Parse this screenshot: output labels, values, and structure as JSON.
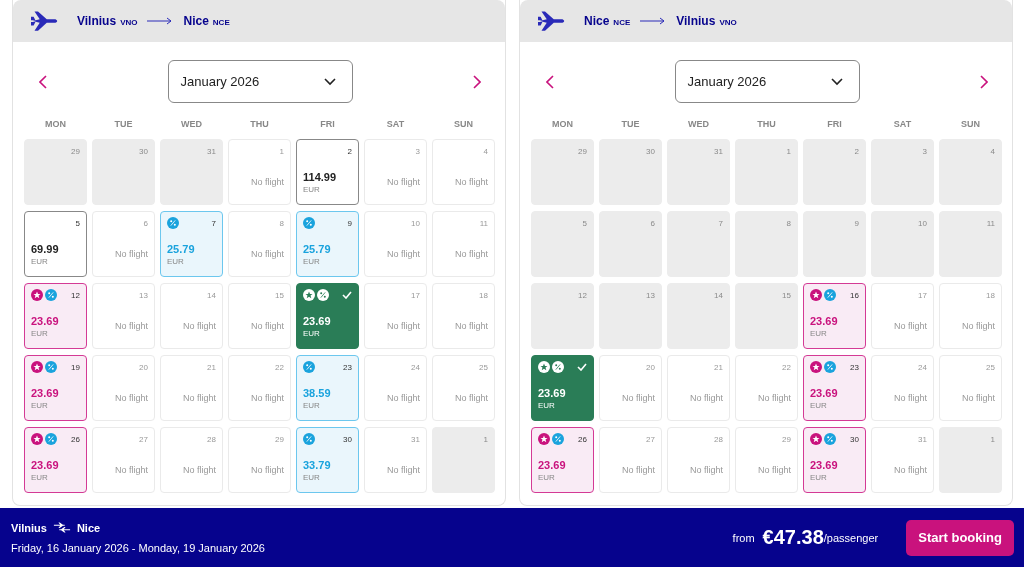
{
  "calendars": [
    {
      "origin": {
        "city": "Vilnius",
        "code": "VNO"
      },
      "destination": {
        "city": "Nice",
        "code": "NCE"
      },
      "month": "January 2026",
      "weekdays": [
        "MON",
        "TUE",
        "WED",
        "THU",
        "FRI",
        "SAT",
        "SUN"
      ],
      "days": [
        {
          "day": "29",
          "kind": "past",
          "selected": false
        },
        {
          "day": "30",
          "kind": "past",
          "selected": false
        },
        {
          "day": "31",
          "kind": "past",
          "selected": false
        },
        {
          "day": "1",
          "kind": "no_flight",
          "note": "No flight",
          "selected": false
        },
        {
          "day": "2",
          "kind": "regular_fare",
          "price": "114.99",
          "currency": "EUR",
          "selected": false
        },
        {
          "day": "3",
          "kind": "no_flight",
          "note": "No flight",
          "selected": false
        },
        {
          "day": "4",
          "kind": "no_flight",
          "note": "No flight",
          "selected": false
        },
        {
          "day": "5",
          "kind": "regular_fare",
          "price": "69.99",
          "currency": "EUR",
          "selected": false
        },
        {
          "day": "6",
          "kind": "no_flight",
          "note": "No flight",
          "selected": false
        },
        {
          "day": "7",
          "kind": "discount_fare",
          "price": "25.79",
          "currency": "EUR",
          "selected": false
        },
        {
          "day": "8",
          "kind": "no_flight",
          "note": "No flight",
          "selected": false
        },
        {
          "day": "9",
          "kind": "discount_fare",
          "price": "25.79",
          "currency": "EUR",
          "selected": false
        },
        {
          "day": "10",
          "kind": "no_flight",
          "note": "No flight",
          "selected": false
        },
        {
          "day": "11",
          "kind": "no_flight",
          "note": "No flight",
          "selected": false
        },
        {
          "day": "12",
          "kind": "club_fare",
          "price": "23.69",
          "currency": "EUR",
          "selected": false
        },
        {
          "day": "13",
          "kind": "no_flight",
          "note": "No flight",
          "selected": false
        },
        {
          "day": "14",
          "kind": "no_flight",
          "note": "No flight",
          "selected": false
        },
        {
          "day": "15",
          "kind": "no_flight",
          "note": "No flight",
          "selected": false
        },
        {
          "kind": "club_fare",
          "price": "23.69",
          "currency": "EUR",
          "selected": true
        },
        {
          "day": "17",
          "kind": "no_flight",
          "note": "No flight",
          "selected": false
        },
        {
          "day": "18",
          "kind": "no_flight",
          "note": "No flight",
          "selected": false
        },
        {
          "day": "19",
          "kind": "club_fare",
          "price": "23.69",
          "currency": "EUR",
          "selected": false
        },
        {
          "day": "20",
          "kind": "no_flight",
          "note": "No flight",
          "selected": false
        },
        {
          "day": "21",
          "kind": "no_flight",
          "note": "No flight",
          "selected": false
        },
        {
          "day": "22",
          "kind": "no_flight",
          "note": "No flight",
          "selected": false
        },
        {
          "day": "23",
          "kind": "discount_fare",
          "price": "38.59",
          "currency": "EUR",
          "selected": false
        },
        {
          "day": "24",
          "kind": "no_flight",
          "note": "No flight",
          "selected": false
        },
        {
          "day": "25",
          "kind": "no_flight",
          "note": "No flight",
          "selected": false
        },
        {
          "day": "26",
          "kind": "club_fare",
          "price": "23.69",
          "currency": "EUR",
          "selected": false
        },
        {
          "day": "27",
          "kind": "no_flight",
          "note": "No flight",
          "selected": false
        },
        {
          "day": "28",
          "kind": "no_flight",
          "note": "No flight",
          "selected": false
        },
        {
          "day": "29",
          "kind": "no_flight",
          "note": "No flight",
          "selected": false
        },
        {
          "day": "30",
          "kind": "discount_fare",
          "price": "33.79",
          "currency": "EUR",
          "selected": false
        },
        {
          "day": "31",
          "kind": "no_flight",
          "note": "No flight",
          "selected": false
        },
        {
          "day": "1",
          "kind": "past",
          "selected": false
        }
      ]
    },
    {
      "origin": {
        "city": "Nice",
        "code": "NCE"
      },
      "destination": {
        "city": "Vilnius",
        "code": "VNO"
      },
      "month": "January 2026",
      "weekdays": [
        "MON",
        "TUE",
        "WED",
        "THU",
        "FRI",
        "SAT",
        "SUN"
      ],
      "days": [
        {
          "day": "29",
          "kind": "past",
          "selected": false
        },
        {
          "day": "30",
          "kind": "past",
          "selected": false
        },
        {
          "day": "31",
          "kind": "past",
          "selected": false
        },
        {
          "day": "1",
          "kind": "past",
          "selected": false
        },
        {
          "day": "2",
          "kind": "past",
          "selected": false
        },
        {
          "day": "3",
          "kind": "past",
          "selected": false
        },
        {
          "day": "4",
          "kind": "past",
          "selected": false
        },
        {
          "day": "5",
          "kind": "past",
          "selected": false
        },
        {
          "day": "6",
          "kind": "past",
          "selected": false
        },
        {
          "day": "7",
          "kind": "past",
          "selected": false
        },
        {
          "day": "8",
          "kind": "past",
          "selected": false
        },
        {
          "day": "9",
          "kind": "past",
          "selected": false
        },
        {
          "day": "10",
          "kind": "past",
          "selected": false
        },
        {
          "day": "11",
          "kind": "past",
          "selected": false
        },
        {
          "day": "12",
          "kind": "past",
          "selected": false
        },
        {
          "day": "13",
          "kind": "past",
          "selected": false
        },
        {
          "day": "14",
          "kind": "past",
          "selected": false
        },
        {
          "day": "15",
          "kind": "past",
          "selected": false
        },
        {
          "day": "16",
          "kind": "club_fare",
          "price": "23.69",
          "currency": "EUR",
          "selected": false
        },
        {
          "day": "17",
          "kind": "no_flight",
          "note": "No flight",
          "selected": false
        },
        {
          "day": "18",
          "kind": "no_flight",
          "note": "No flight",
          "selected": false
        },
        {
          "kind": "club_fare",
          "price": "23.69",
          "currency": "EUR",
          "selected": true
        },
        {
          "day": "20",
          "kind": "no_flight",
          "note": "No flight",
          "selected": false
        },
        {
          "day": "21",
          "kind": "no_flight",
          "note": "No flight",
          "selected": false
        },
        {
          "day": "22",
          "kind": "no_flight",
          "note": "No flight",
          "selected": false
        },
        {
          "day": "23",
          "kind": "club_fare",
          "price": "23.69",
          "currency": "EUR",
          "selected": false
        },
        {
          "day": "24",
          "kind": "no_flight",
          "note": "No flight",
          "selected": false
        },
        {
          "day": "25",
          "kind": "no_flight",
          "note": "No flight",
          "selected": false
        },
        {
          "day": "26",
          "kind": "club_fare",
          "price": "23.69",
          "currency": "EUR",
          "selected": false
        },
        {
          "day": "27",
          "kind": "no_flight",
          "note": "No flight",
          "selected": false
        },
        {
          "day": "28",
          "kind": "no_flight",
          "note": "No flight",
          "selected": false
        },
        {
          "day": "29",
          "kind": "no_flight",
          "note": "No flight",
          "selected": false
        },
        {
          "day": "30",
          "kind": "club_fare",
          "price": "23.69",
          "currency": "EUR",
          "selected": false
        },
        {
          "day": "31",
          "kind": "no_flight",
          "note": "No flight",
          "selected": false
        },
        {
          "day": "1",
          "kind": "past",
          "selected": false
        }
      ]
    }
  ],
  "summary": {
    "origin": "Vilnius",
    "destination": "Nice",
    "dates": "Friday, 16 January 2026 - Monday, 19 January 2026",
    "price_prefix": "from",
    "price": "€47.38",
    "price_suffix": "/passenger",
    "button": "Start booking"
  }
}
